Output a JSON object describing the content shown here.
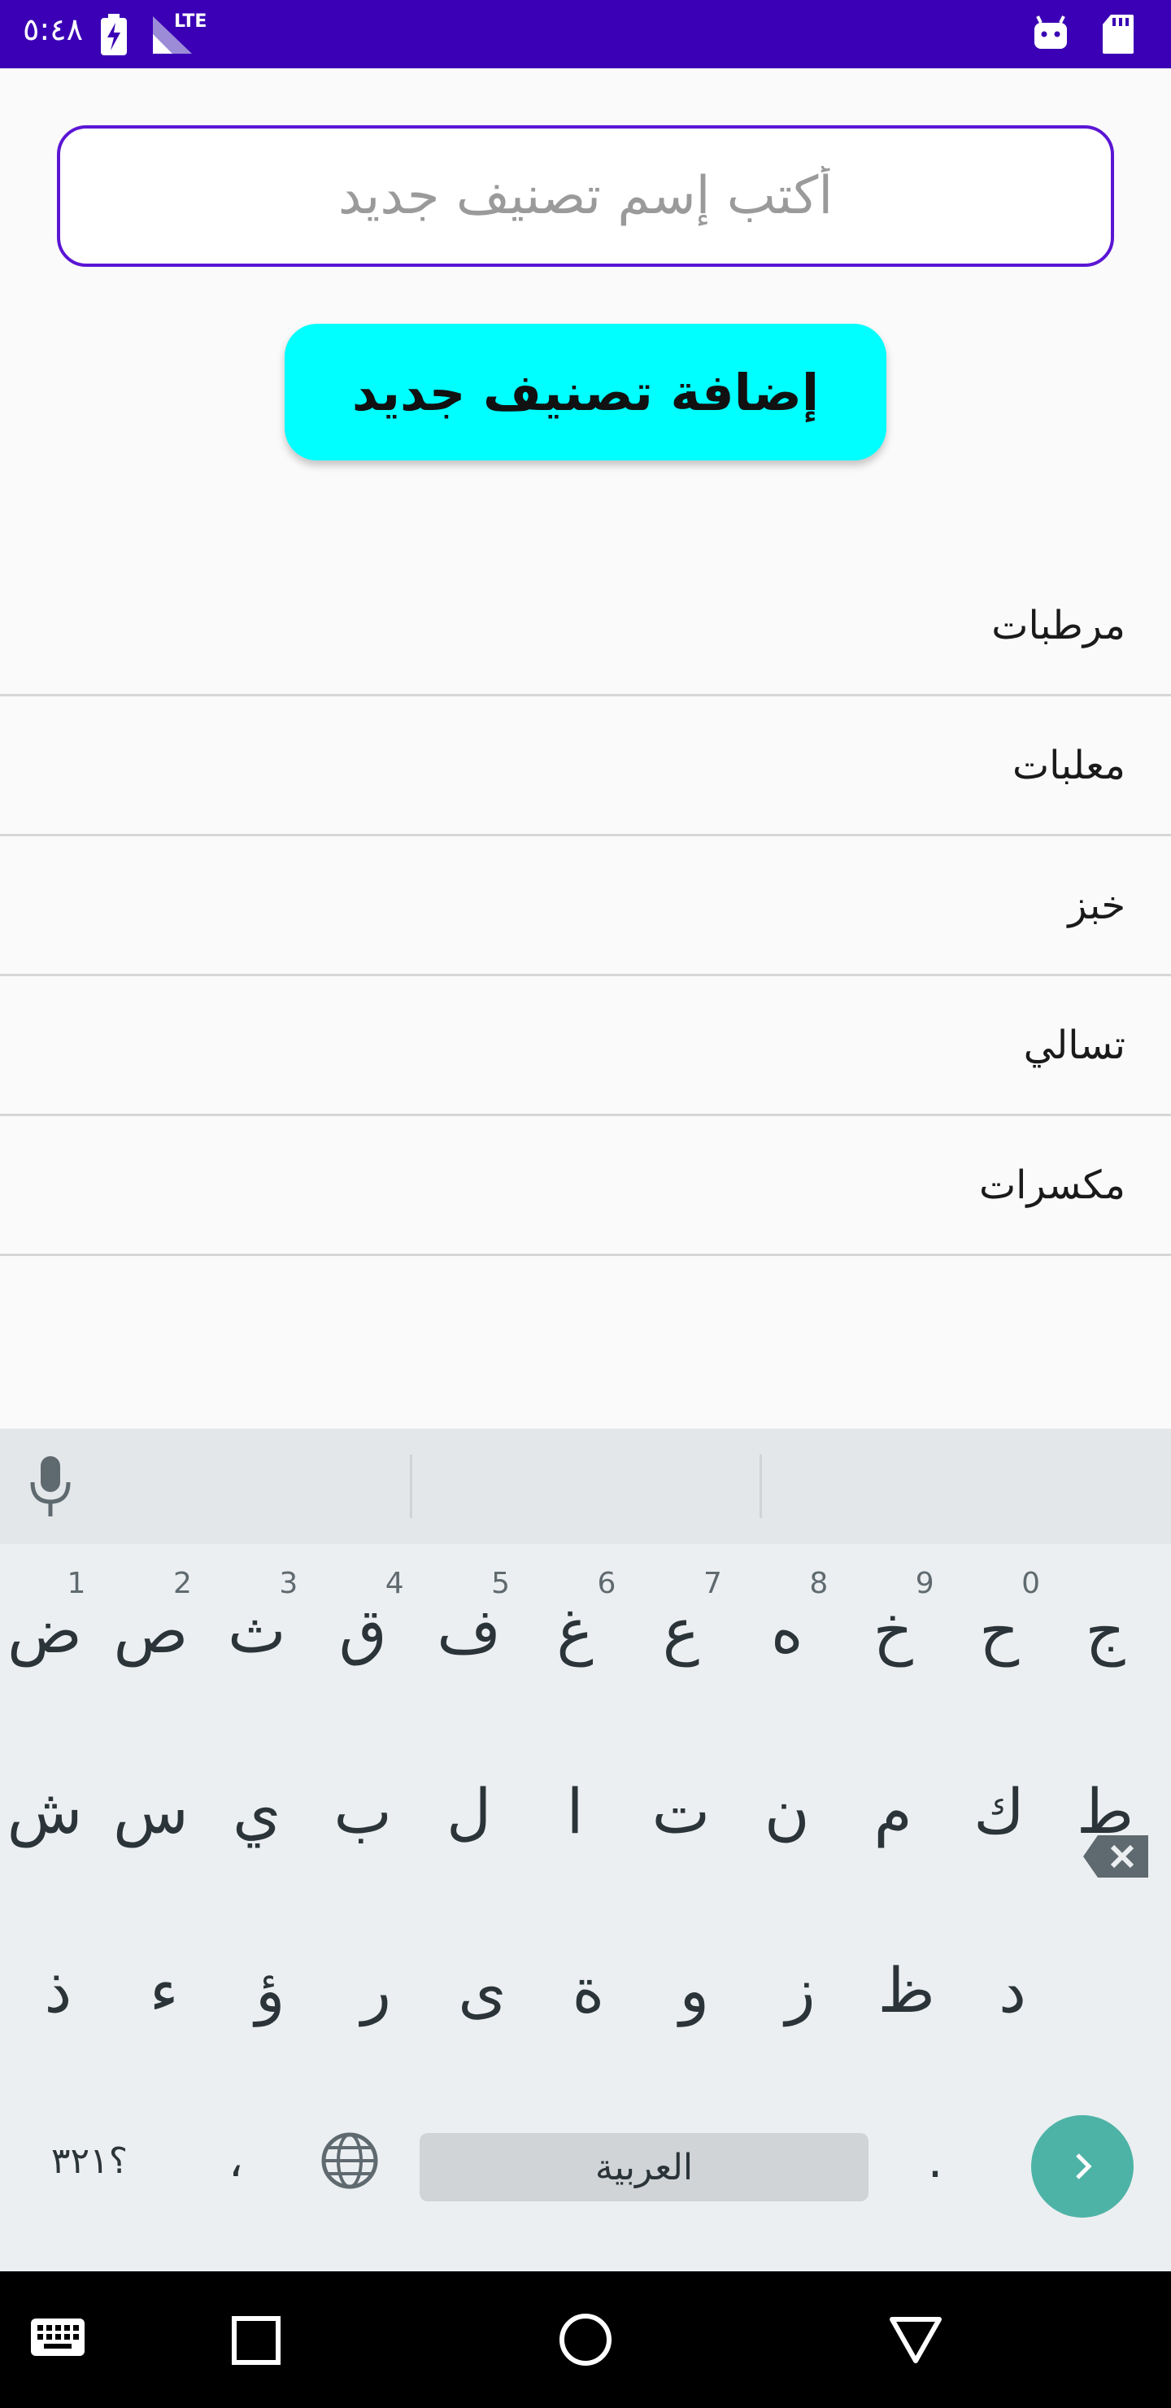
{
  "status_bar": {
    "time": "٥:٤٨",
    "network": "LTE",
    "icons": [
      "battery-charging-icon",
      "signal-icon",
      "android-icon",
      "sd-card-icon"
    ],
    "background": "#3b00b5"
  },
  "form": {
    "input_placeholder": "أكتب إسم تصنيف جديد",
    "input_value": "",
    "add_button_label": "إضافة تصنيف جديد",
    "accent": "#5b16d4",
    "button_color": "#00ffff"
  },
  "categories": [
    {
      "label": "مرطبات"
    },
    {
      "label": "معلبات"
    },
    {
      "label": "خبز"
    },
    {
      "label": "تسالي"
    },
    {
      "label": "مكسرات"
    }
  ],
  "keyboard": {
    "row1": [
      {
        "char": "ج",
        "hint": ""
      },
      {
        "char": "ح",
        "hint": "0"
      },
      {
        "char": "خ",
        "hint": "9"
      },
      {
        "char": "ه",
        "hint": "8"
      },
      {
        "char": "ع",
        "hint": "7"
      },
      {
        "char": "غ",
        "hint": "6"
      },
      {
        "char": "ف",
        "hint": "5"
      },
      {
        "char": "ق",
        "hint": "4"
      },
      {
        "char": "ث",
        "hint": "3"
      },
      {
        "char": "ص",
        "hint": "2"
      },
      {
        "char": "ض",
        "hint": "1"
      }
    ],
    "row2": [
      "ط",
      "ك",
      "م",
      "ن",
      "ت",
      "ا",
      "ل",
      "ب",
      "ي",
      "س",
      "ش"
    ],
    "row3": [
      "د",
      "ظ",
      "ز",
      "و",
      "ة",
      "ى",
      "ر",
      "ؤ",
      "ء",
      "ذ"
    ],
    "symbols_label": "؟٣٢١",
    "comma_label": "،",
    "space_label": "العربية",
    "period_label": ".",
    "enter_color": "#4eb3a7"
  }
}
